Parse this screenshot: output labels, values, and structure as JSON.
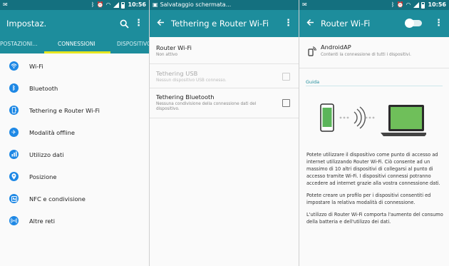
{
  "status": {
    "time": "10:56",
    "screen2_notification": "Salvataggio schermata..."
  },
  "screen1": {
    "title": "Impostaz.",
    "tabs": [
      "POSTAZIONI...",
      "CONNESSIONI",
      "DISPOSITIVO"
    ],
    "active_tab": 1,
    "items": [
      {
        "label": "Wi-Fi",
        "icon": "wifi-icon"
      },
      {
        "label": "Bluetooth",
        "icon": "bluetooth-icon"
      },
      {
        "label": "Tethering e Router Wi-Fi",
        "icon": "tethering-icon"
      },
      {
        "label": "Modalità offline",
        "icon": "airplane-icon"
      },
      {
        "label": "Utilizzo dati",
        "icon": "data-usage-icon"
      },
      {
        "label": "Posizione",
        "icon": "location-icon"
      },
      {
        "label": "NFC e condivisione",
        "icon": "nfc-icon"
      },
      {
        "label": "Altre reti",
        "icon": "more-networks-icon"
      }
    ]
  },
  "screen2": {
    "title": "Tethering e Router Wi-Fi",
    "rows": [
      {
        "title": "Router Wi-Fi",
        "subtitle": "Non attivo",
        "checkbox": false,
        "enabled": true
      },
      {
        "title": "Tethering USB",
        "subtitle": "Nessun dispositivo USB connesso.",
        "checkbox": true,
        "checked": false,
        "enabled": false
      },
      {
        "title": "Tethering Bluetooth",
        "subtitle": "Nessuna condivisione della connessione dati del dispositivo.",
        "checkbox": true,
        "checked": false,
        "enabled": true
      }
    ]
  },
  "screen3": {
    "title": "Router Wi-Fi",
    "toggle_on": false,
    "ap_name": "AndroidAP",
    "ap_subtitle": "Contenti la connessione di tutti i dispositivi.",
    "guide_label": "Guida",
    "paragraph1": "Potete utilizzare il dispositivo come punto di accesso ad internet utilizzando Router Wi-Fi. Ciò consente ad un massimo di 10 altri dispositivi di collegarsi al punto di accesso tramite Wi-Fi. I dispositivi connessi potranno accedere ad internet grazie alla vostra connessione dati.",
    "paragraph2": "Potete creare un profilo per i dispositivi consentiti ed impostare la relativa modalità di connessione.",
    "paragraph3": "L'utilizzo di Router Wi-Fi comporta l'aumento del consumo della batteria e dell'utilizzo dei dati."
  },
  "colors": {
    "status_bar": "#14707f",
    "app_bar": "#1d8d9c",
    "tab_indicator": "#e6e620",
    "icon_blue": "#1e88e5",
    "laptop_screen": "#6fbf5a"
  }
}
